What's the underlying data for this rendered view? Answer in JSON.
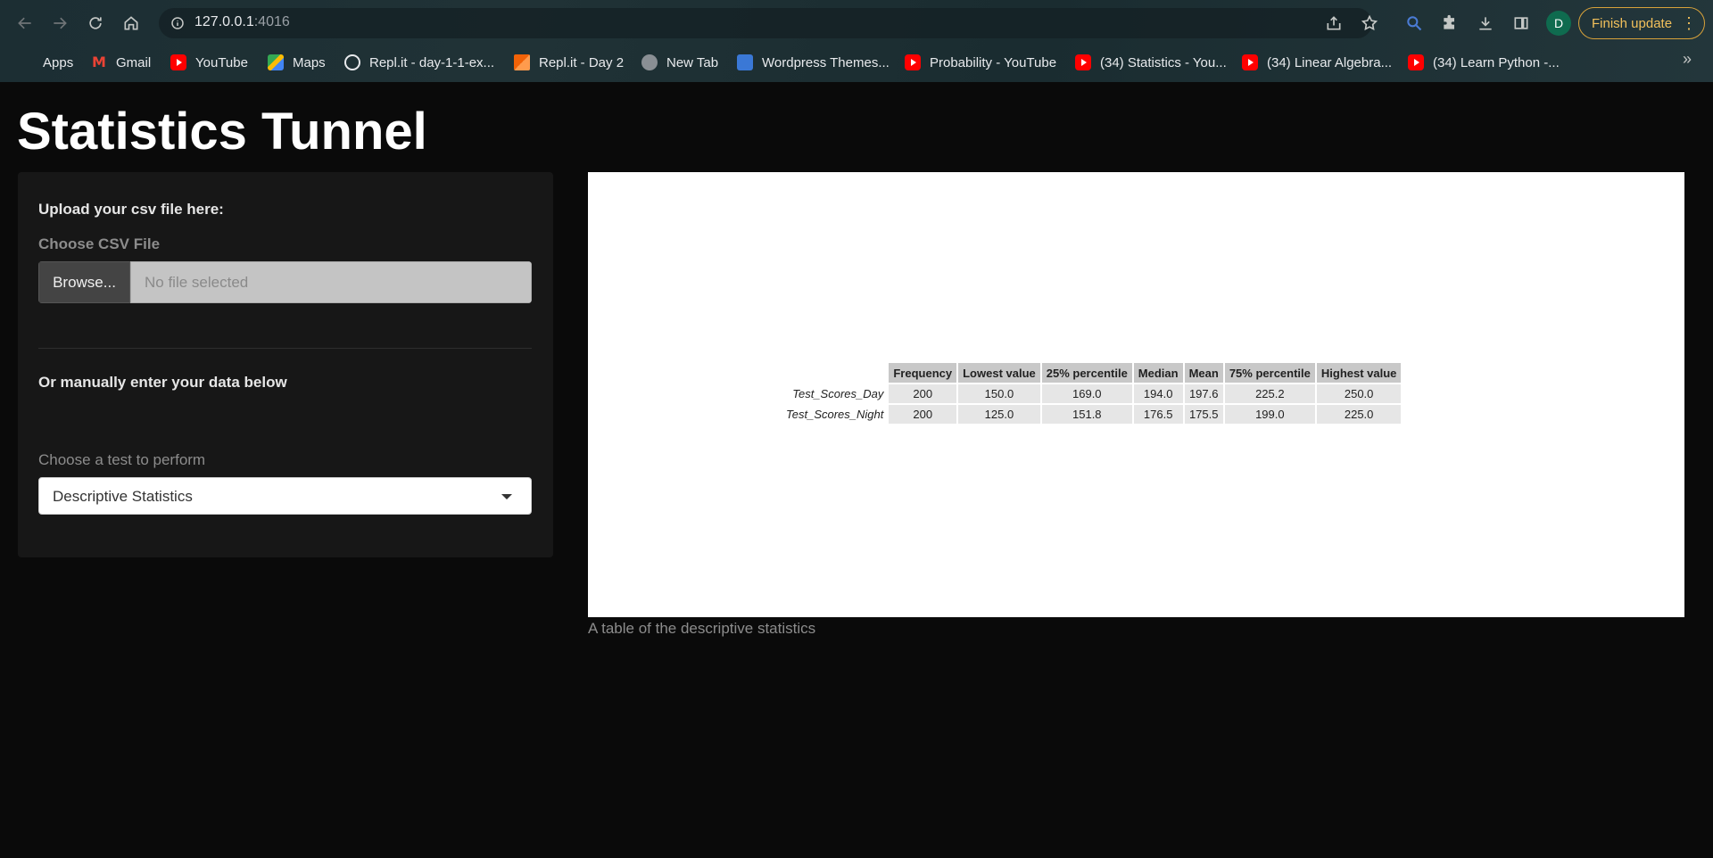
{
  "browser": {
    "url_host": "127.0.0.1",
    "url_port": ":4016",
    "finish_update_label": "Finish update",
    "avatar_initial": "D",
    "accent_color": "#f2c05b"
  },
  "bookmarks": [
    {
      "label": "Apps",
      "icon": "apps-grid-icon"
    },
    {
      "label": "Gmail",
      "icon": "gmail-icon"
    },
    {
      "label": "YouTube",
      "icon": "youtube-icon"
    },
    {
      "label": "Maps",
      "icon": "maps-icon"
    },
    {
      "label": "Repl.it - day-1-1-ex...",
      "icon": "replit-icon"
    },
    {
      "label": "Repl.it - Day 2",
      "icon": "replit-icon"
    },
    {
      "label": "New Tab",
      "icon": "globe-icon"
    },
    {
      "label": "Wordpress Themes...",
      "icon": "wordpress-icon"
    },
    {
      "label": "Probability - YouTube",
      "icon": "youtube-icon"
    },
    {
      "label": "(34) Statistics - You...",
      "icon": "youtube-icon"
    },
    {
      "label": "(34) Linear Algebra...",
      "icon": "youtube-icon"
    },
    {
      "label": "(34) Learn Python -...",
      "icon": "youtube-icon"
    }
  ],
  "page": {
    "title": "Statistics Tunnel"
  },
  "sidebar": {
    "upload_label": "Upload your csv file here:",
    "choose_csv_label": "Choose CSV File",
    "browse_label": "Browse...",
    "file_placeholder": "No file selected",
    "manual_label": "Or manually enter your data below",
    "test_label": "Choose a test to perform",
    "test_selected": "Descriptive Statistics"
  },
  "output": {
    "columns": [
      "Frequency",
      "Lowest value",
      "25% percentile",
      "Median",
      "Mean",
      "75% percentile",
      "Highest value"
    ],
    "rows": [
      {
        "name": "Test_Scores_Day",
        "values": [
          "200",
          "150.0",
          "169.0",
          "194.0",
          "197.6",
          "225.2",
          "250.0"
        ]
      },
      {
        "name": "Test_Scores_Night",
        "values": [
          "200",
          "125.0",
          "151.8",
          "176.5",
          "175.5",
          "199.0",
          "225.0"
        ]
      }
    ],
    "caption": "A table of the descriptive statistics"
  }
}
